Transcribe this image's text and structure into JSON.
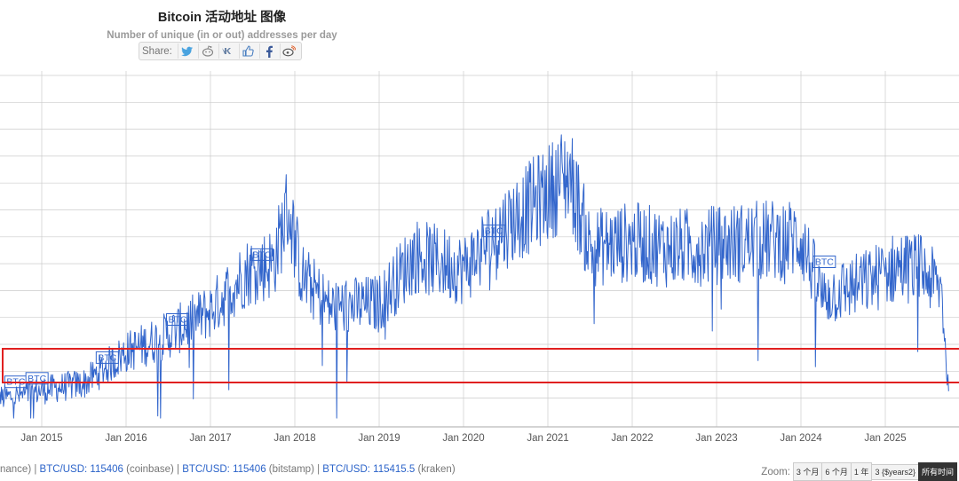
{
  "header": {
    "title": "Bitcoin 活动地址 图像",
    "subtitle": "Number of unique (in or out) addresses per day"
  },
  "share": {
    "label": "Share:",
    "icons": [
      "twitter-icon",
      "reddit-icon",
      "vk-icon",
      "like-icon",
      "facebook-icon",
      "weibo-icon"
    ]
  },
  "footer": {
    "segments": [
      {
        "text": "nance) | ",
        "price": false
      },
      {
        "text": "BTC/USD: 115406",
        "price": true
      },
      {
        "text": " (coinbase) | ",
        "price": false
      },
      {
        "text": "BTC/USD: 115406",
        "price": true
      },
      {
        "text": " (bitstamp) | ",
        "price": false
      },
      {
        "text": "BTC/USD: 115415.5",
        "price": true
      },
      {
        "text": " (kraken)",
        "price": false
      }
    ]
  },
  "zoom": {
    "label": "Zoom:",
    "buttons": [
      {
        "label": "3 个月",
        "active": false
      },
      {
        "label": "6 个月",
        "active": false
      },
      {
        "label": "1 年",
        "active": false
      },
      {
        "label": "3 {$years2}",
        "active": false
      },
      {
        "label": "所有时间",
        "active": true
      }
    ]
  },
  "colors": {
    "series": "#3366cc",
    "grid": "#cccccc",
    "highlight": "#e02020",
    "active_button": "#333333"
  },
  "chart_data": {
    "type": "line",
    "title": "Bitcoin 活动地址 图像",
    "subtitle": "Number of unique (in or out) addresses per day",
    "xlabel": "",
    "ylabel": "",
    "x_start": "2014-06",
    "x_end": "2025-10",
    "x_ticks": [
      "Jan 2015",
      "Jan 2016",
      "Jan 2017",
      "Jan 2018",
      "Jan 2019",
      "Jan 2020",
      "Jan 2021",
      "Jan 2022",
      "Jan 2023",
      "Jan 2024",
      "Jan 2025"
    ],
    "y_tick_labels_visible": false,
    "grid": true,
    "series": [
      {
        "name": "",
        "color": "#3366cc",
        "anchors": [
          {
            "t": "2014-06",
            "v": 0.065
          },
          {
            "t": "2014-10",
            "v": 0.075
          },
          {
            "t": "2015-01",
            "v": 0.09
          },
          {
            "t": "2015-07",
            "v": 0.11
          },
          {
            "t": "2016-01",
            "v": 0.2
          },
          {
            "t": "2016-07",
            "v": 0.25
          },
          {
            "t": "2017-01",
            "v": 0.32
          },
          {
            "t": "2017-06",
            "v": 0.43
          },
          {
            "t": "2017-10",
            "v": 0.46
          },
          {
            "t": "2017-12",
            "v": 0.62
          },
          {
            "t": "2018-02",
            "v": 0.42
          },
          {
            "t": "2018-06",
            "v": 0.33
          },
          {
            "t": "2019-01",
            "v": 0.34
          },
          {
            "t": "2019-06",
            "v": 0.48
          },
          {
            "t": "2020-01",
            "v": 0.44
          },
          {
            "t": "2020-06",
            "v": 0.55
          },
          {
            "t": "2021-01",
            "v": 0.66
          },
          {
            "t": "2021-04",
            "v": 0.72
          },
          {
            "t": "2021-07",
            "v": 0.5
          },
          {
            "t": "2022-01",
            "v": 0.52
          },
          {
            "t": "2022-06",
            "v": 0.5
          },
          {
            "t": "2023-01",
            "v": 0.51
          },
          {
            "t": "2023-06",
            "v": 0.52
          },
          {
            "t": "2024-01",
            "v": 0.53
          },
          {
            "t": "2024-04",
            "v": 0.36
          },
          {
            "t": "2024-10",
            "v": 0.4
          },
          {
            "t": "2025-03",
            "v": 0.45
          },
          {
            "t": "2025-06",
            "v": 0.44
          },
          {
            "t": "2025-09",
            "v": 0.38
          },
          {
            "t": "2025-10",
            "v": 0.08
          }
        ]
      }
    ],
    "flags": [
      {
        "t": "2014-08",
        "label": "BTC"
      },
      {
        "t": "2014-11",
        "label": "BTC"
      },
      {
        "t": "2015-09",
        "label": "BTC"
      },
      {
        "t": "2016-07",
        "label": "BTC"
      },
      {
        "t": "2017-07",
        "label": "BTC"
      },
      {
        "t": "2020-04",
        "label": "BTC"
      },
      {
        "t": "2024-03",
        "label": "BTC"
      }
    ],
    "legend": "none"
  }
}
